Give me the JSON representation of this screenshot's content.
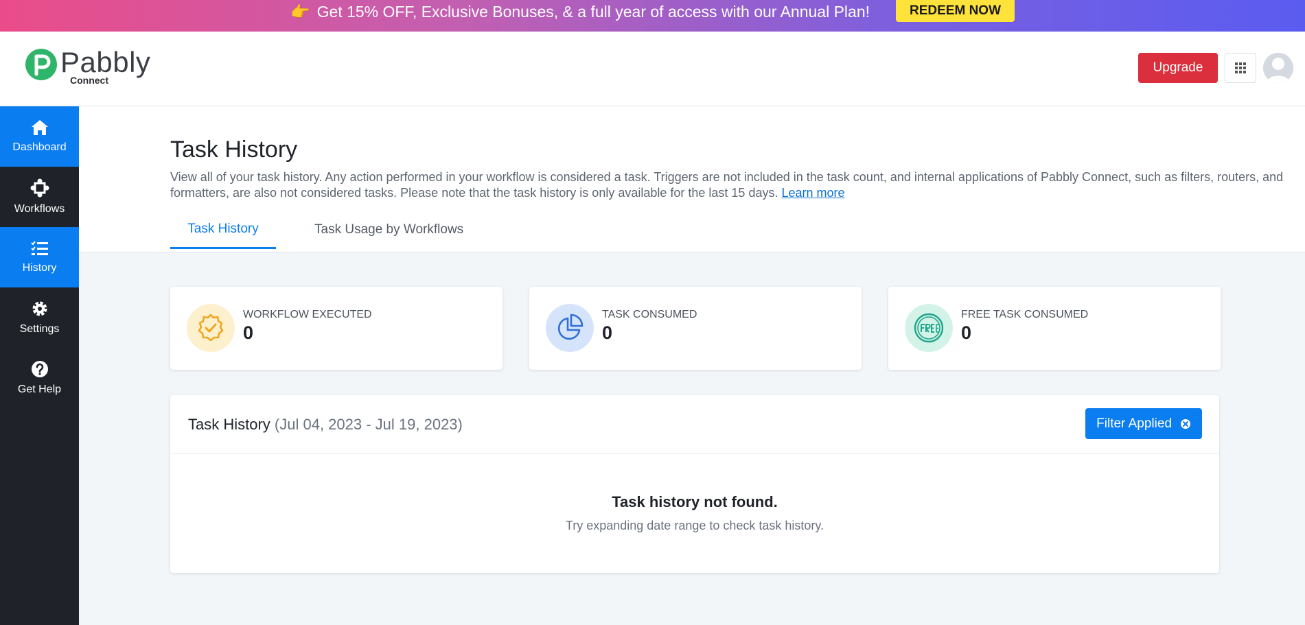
{
  "banner": {
    "text": "Get 15% OFF, Exclusive Bonuses, & a full year of access with our Annual Plan!",
    "emoji": "👉",
    "cta": "REDEEM NOW"
  },
  "brand": {
    "name": "Pabbly",
    "sub": "Connect",
    "accent": "#2fb56a"
  },
  "header": {
    "upgrade_label": "Upgrade"
  },
  "sidebar": {
    "items": [
      {
        "label": "Dashboard",
        "icon": "home-icon",
        "active": true
      },
      {
        "label": "Workflows",
        "icon": "workflow-icon",
        "active": false
      },
      {
        "label": "History",
        "icon": "history-list-icon",
        "active": true
      },
      {
        "label": "Settings",
        "icon": "gear-icon",
        "active": false
      },
      {
        "label": "Get Help",
        "icon": "help-icon",
        "active": false
      }
    ]
  },
  "page": {
    "title": "Task History",
    "description": "View all of your task history. Any action performed in your workflow is considered a task. Triggers are not included in the task count, and internal applications of Pabbly Connect, such as filters, routers, and formatters, are also not considered tasks. Please note that the task history is only available for the last 15 days.",
    "learn_more": "Learn more"
  },
  "tabs": [
    {
      "label": "Task History",
      "active": true
    },
    {
      "label": "Task Usage by Workflows",
      "active": false
    }
  ],
  "stats": [
    {
      "label": "WORKFLOW EXECUTED",
      "value": "0",
      "icon": "badge-check-icon",
      "color": "#f2a51a"
    },
    {
      "label": "TASK CONSUMED",
      "value": "0",
      "icon": "pie-chart-icon",
      "color": "#2f6fd8"
    },
    {
      "label": "FREE TASK CONSUMED",
      "value": "0",
      "icon": "free-badge-icon",
      "color": "#1ea58a"
    }
  ],
  "history_panel": {
    "title": "Task History",
    "range": "(Jul 04, 2023 - Jul 19, 2023)",
    "filter_label": "Filter Applied",
    "empty_title": "Task history not found.",
    "empty_subtitle": "Try expanding date range to check task history."
  },
  "colors": {
    "primary": "#0a7df0",
    "danger": "#dc2f3d",
    "sidebar": "#1f2329"
  }
}
